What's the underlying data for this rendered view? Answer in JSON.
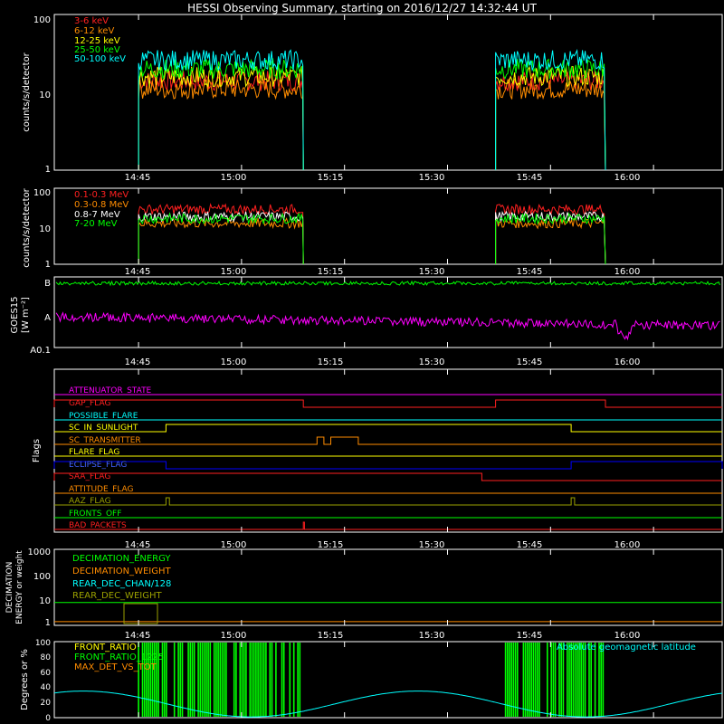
{
  "title": "HESSI Observing Summary, starting on 2016/12/27 14:32:44 UT",
  "time_ticks": [
    "14:45",
    "15:00",
    "15:15",
    "15:30",
    "15:45",
    "16:00"
  ],
  "colors": {
    "red": "#ff2020",
    "orange": "#ff8c00",
    "yellow": "#ffff00",
    "green": "#00ff00",
    "cyan": "#00ffff",
    "white": "#ffffff",
    "magenta": "#ff00ff",
    "blue": "#0000ff",
    "olive": "#9aa000"
  },
  "chart_data": [
    {
      "type": "line",
      "panel": "count-rates-low",
      "ylabel": "counts/s/detector",
      "yscale": "log",
      "ylim": [
        1,
        100
      ],
      "y_tick_labels": [
        "1",
        "10",
        "100"
      ],
      "xlim": [
        "14:32:44",
        "16:10"
      ],
      "observing_intervals": [
        [
          "14:45",
          "15:09"
        ],
        [
          "15:37",
          "15:53"
        ]
      ],
      "series": [
        {
          "name": "3-6 keV",
          "color": "red",
          "level": 14
        },
        {
          "name": "6-12 keV",
          "color": "orange",
          "level": 11
        },
        {
          "name": "12-25 keV",
          "color": "yellow",
          "level": 16
        },
        {
          "name": "25-50 keV",
          "color": "green",
          "level": 20
        },
        {
          "name": "50-100 keV",
          "color": "cyan",
          "level": 26
        }
      ]
    },
    {
      "type": "line",
      "panel": "count-rates-high",
      "ylabel": "counts/s/detector",
      "yscale": "log",
      "ylim": [
        1,
        100
      ],
      "y_tick_labels": [
        "1",
        "10",
        "100"
      ],
      "observing_intervals": [
        [
          "14:45",
          "15:09"
        ],
        [
          "15:37",
          "15:53"
        ]
      ],
      "series": [
        {
          "name": "0.1-0.3 MeV",
          "color": "red",
          "level": 28
        },
        {
          "name": "0.3-0.8 MeV",
          "color": "orange",
          "level": 12
        },
        {
          "name": "0.8-7 MeV",
          "color": "white",
          "level": 18
        },
        {
          "name": "7-20 MeV",
          "color": "green",
          "level": 16
        }
      ]
    },
    {
      "type": "line",
      "panel": "goes",
      "ylabel": "GOES15",
      "yunits": "[W m⁻²]",
      "y_tick_labels": [
        "B",
        "A",
        "A0.1"
      ],
      "series": [
        {
          "color": "green",
          "level": "B"
        },
        {
          "color": "magenta",
          "level": "A"
        }
      ]
    },
    {
      "type": "table",
      "panel": "flags",
      "ylabel": "Flags",
      "flags": [
        {
          "name": "ATTENUATOR_STATE",
          "color": "magenta",
          "segments": []
        },
        {
          "name": "GAP_FLAG",
          "color": "red",
          "segments": [
            [
              "14:32:44",
              "15:09"
            ],
            [
              "15:37",
              "15:53"
            ]
          ]
        },
        {
          "name": "POSSIBLE_FLARE",
          "color": "cyan",
          "segments": []
        },
        {
          "name": "SC_IN_SUNLIGHT",
          "color": "yellow",
          "segments": [
            [
              "14:49",
              "15:48"
            ]
          ]
        },
        {
          "name": "SC_TRANSMITTER",
          "color": "orange",
          "segments": [
            [
              "15:11",
              "15:12"
            ],
            [
              "15:13",
              "15:17"
            ]
          ]
        },
        {
          "name": "FLARE_FLAG",
          "color": "yellow",
          "segments": []
        },
        {
          "name": "ECLIPSE_FLAG",
          "color": "blue",
          "segments": [
            [
              "14:32:44",
              "14:49"
            ],
            [
              "15:48",
              "16:10"
            ]
          ]
        },
        {
          "name": "SAA_FLAG",
          "color": "red",
          "segments": [
            [
              "14:32:44",
              "15:35"
            ]
          ]
        },
        {
          "name": "ATTITUDE_FLAG",
          "color": "orange",
          "segments": []
        },
        {
          "name": "AAZ_FLAG",
          "color": "olive",
          "segments": [
            [
              "14:49",
              "14:49:30"
            ],
            [
              "15:48",
              "15:48:30"
            ]
          ]
        },
        {
          "name": "FRONTS_OFF",
          "color": "green",
          "segments": []
        },
        {
          "name": "BAD_PACKETS",
          "color": "red",
          "segments": [
            [
              "15:09",
              "15:09:10"
            ]
          ]
        }
      ]
    },
    {
      "type": "line",
      "panel": "decimation",
      "ylabel": "DECIMATION ENERGY or weight",
      "yscale": "log",
      "ylim": [
        1,
        1000
      ],
      "y_tick_labels": [
        "1",
        "10",
        "100",
        "1000"
      ],
      "series": [
        {
          "name": "DECIMATION_ENERGY",
          "color": "green",
          "value": 8
        },
        {
          "name": "DECIMATION_WEIGHT",
          "color": "orange",
          "value": 1.4
        },
        {
          "name": "REAR_DEC_CHAN/128",
          "color": "cyan",
          "value": null
        },
        {
          "name": "REAR_DEC_WEIGHT",
          "color": "olive",
          "value": null
        }
      ]
    },
    {
      "type": "line",
      "panel": "ratios",
      "ylabel": "Degrees or %",
      "ylim": [
        0,
        100
      ],
      "y_tick_labels": [
        "0",
        "20",
        "40",
        "60",
        "80",
        "100"
      ],
      "series": [
        {
          "name": "FRONT_RATIO",
          "color": "yellow"
        },
        {
          "name": "FRONT_RATIO_1225",
          "color": "green"
        },
        {
          "name": "MAX_DET_VS_TOT",
          "color": "orange"
        },
        {
          "name": "Absolute geomagnetic latitude",
          "color": "cyan"
        }
      ]
    }
  ]
}
